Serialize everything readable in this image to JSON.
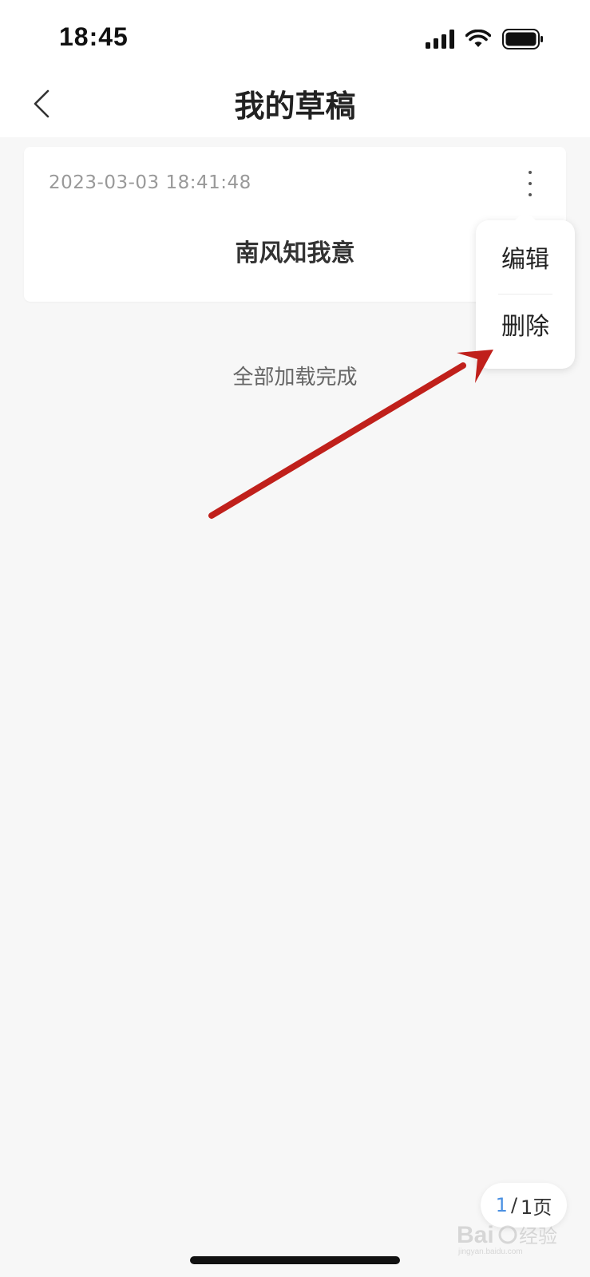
{
  "status_bar": {
    "time": "18:45",
    "icons": [
      "signal-icon",
      "wifi-icon",
      "battery-icon"
    ]
  },
  "nav": {
    "title": "我的草稿",
    "back_icon": "chevron-left-icon"
  },
  "draft": {
    "timestamp": "2023-03-03 18:41:48",
    "title": "南风知我意",
    "more_icon": "more-vertical-icon"
  },
  "popup_menu": {
    "edit_label": "编辑",
    "delete_label": "删除"
  },
  "list_footer": "全部加载完成",
  "pagination": {
    "current": "1",
    "separator": "/",
    "total": "1页"
  },
  "watermark": {
    "text": "Baidu经验",
    "subtext": "jingyan.baidu.com"
  },
  "colors": {
    "background": "#f7f7f7",
    "card": "#ffffff",
    "annotation_arrow": "#c0201b",
    "page_current": "#4a90e2",
    "muted_text": "#999999"
  }
}
